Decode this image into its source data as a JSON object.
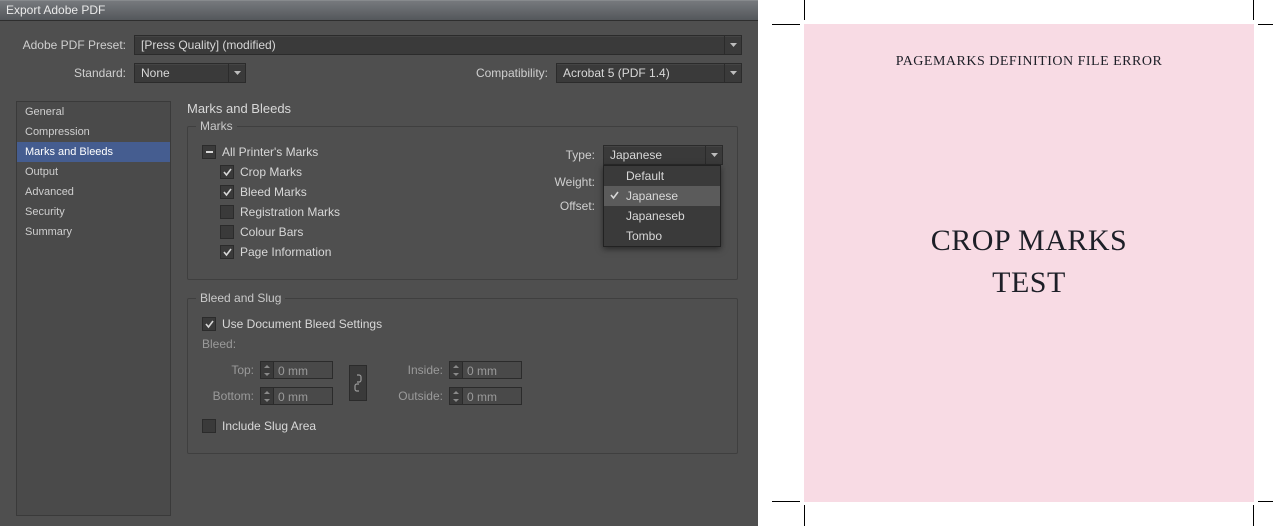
{
  "dialog": {
    "title": "Export Adobe PDF",
    "preset_label": "Adobe PDF Preset:",
    "preset_value": "[Press Quality] (modified)",
    "standard_label": "Standard:",
    "standard_value": "None",
    "compat_label": "Compatibility:",
    "compat_value": "Acrobat 5 (PDF 1.4)"
  },
  "nav": {
    "items": [
      "General",
      "Compression",
      "Marks and Bleeds",
      "Output",
      "Advanced",
      "Security",
      "Summary"
    ],
    "selected_index": 2
  },
  "panel": {
    "title": "Marks and Bleeds",
    "marks_legend": "Marks",
    "all_printer_marks": "All Printer's Marks",
    "crop_marks": "Crop Marks",
    "bleed_marks": "Bleed Marks",
    "registration_marks": "Registration Marks",
    "colour_bars": "Colour Bars",
    "page_information": "Page Information",
    "type_label": "Type:",
    "type_value": "Japanese",
    "type_options": [
      "Default",
      "Japanese",
      "Japaneseb",
      "Tombo"
    ],
    "type_selected_index": 1,
    "weight_label": "Weight:",
    "offset_label": "Offset:",
    "bleed_legend": "Bleed and Slug",
    "use_doc_bleed": "Use Document Bleed Settings",
    "bleed_subtitle": "Bleed:",
    "top_label": "Top:",
    "bottom_label": "Bottom:",
    "inside_label": "Inside:",
    "outside_label": "Outside:",
    "top_value": "0 mm",
    "bottom_value": "0 mm",
    "inside_value": "0 mm",
    "outside_value": "0 mm",
    "include_slug": "Include Slug Area"
  },
  "preview": {
    "error_title": "PAGEMARKS DEFINITION FILE ERROR",
    "line1": "CROP MARKS",
    "line2": "TEST"
  }
}
